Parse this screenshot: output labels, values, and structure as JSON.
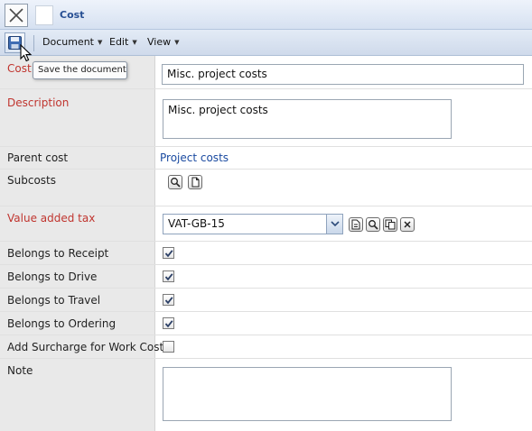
{
  "window": {
    "title": "Cost",
    "close_icon": "close-x-icon",
    "doc_icon": "blank-document-icon"
  },
  "toolbar": {
    "save_icon": "floppy-disk-icon",
    "menus": [
      {
        "label": "Document"
      },
      {
        "label": "Edit"
      },
      {
        "label": "View"
      }
    ]
  },
  "tooltip": {
    "text": "Save the document"
  },
  "form": {
    "cost": {
      "label": "Cost",
      "value": "Misc. project costs"
    },
    "description": {
      "label": "Description",
      "value": "Misc. project costs"
    },
    "parent_cost": {
      "label": "Parent cost",
      "value": "Project costs"
    },
    "subcosts": {
      "label": "Subcosts",
      "icons": [
        "search-icon",
        "new-document-icon"
      ]
    },
    "vat": {
      "label": "Value added tax",
      "value": "VAT-GB-15",
      "icons": [
        "open-document-icon",
        "search-icon",
        "copy-icon",
        "clear-icon"
      ]
    },
    "receipt": {
      "label": "Belongs to Receipt",
      "checked": true
    },
    "drive": {
      "label": "Belongs to Drive",
      "checked": true
    },
    "travel": {
      "label": "Belongs to Travel",
      "checked": true
    },
    "ordering": {
      "label": "Belongs to Ordering",
      "checked": true
    },
    "surcharge": {
      "label": "Add Surcharge for Work Cost",
      "checked": false
    },
    "note": {
      "label": "Note",
      "value": ""
    }
  },
  "colors": {
    "required_label": "#c0352f",
    "link": "#1a4aa0",
    "title": "#274f93"
  }
}
